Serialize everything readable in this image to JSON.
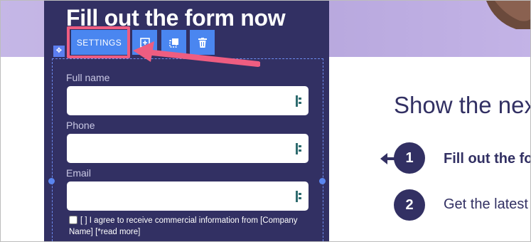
{
  "form": {
    "title": "Fill out the form now",
    "fields": [
      {
        "label": "Full name",
        "value": ""
      },
      {
        "label": "Phone",
        "value": ""
      },
      {
        "label": "Email",
        "value": ""
      }
    ],
    "consent": "[ ] I agree to receive commercial information from [Company Name] [*read more]"
  },
  "toolbar": {
    "settings_label": "SETTINGS",
    "icons": [
      "add-block-icon",
      "duplicate-icon",
      "trash-icon"
    ]
  },
  "right": {
    "heading": "Show the nex",
    "steps": [
      {
        "number": "1",
        "text": "Fill out the fo"
      },
      {
        "number": "2",
        "text": "Get the latest"
      }
    ]
  },
  "colors": {
    "form_bg": "#323063",
    "toolbar_blue": "#4a86f0",
    "annotation_pink": "#ee5d81",
    "band": "#c5b7e6"
  }
}
